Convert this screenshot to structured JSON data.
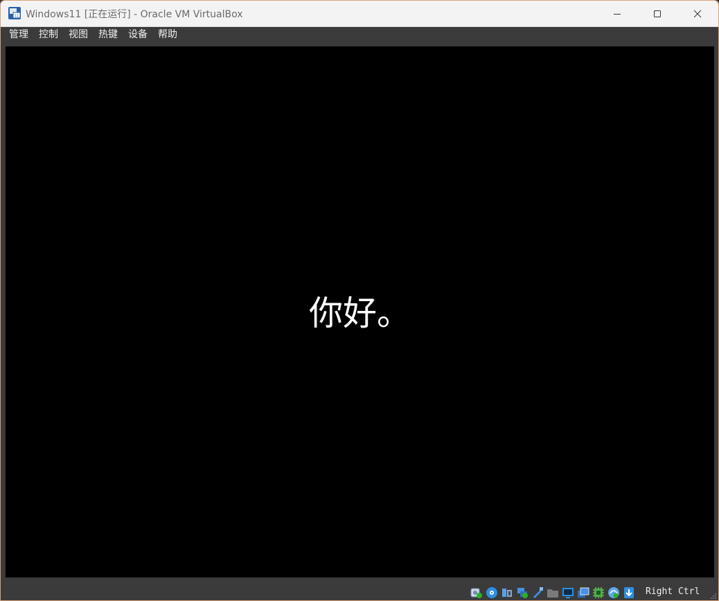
{
  "window": {
    "title": "Windows11 [正在运行] - Oracle VM VirtualBox"
  },
  "menu": {
    "items": [
      {
        "label": "管理"
      },
      {
        "label": "控制"
      },
      {
        "label": "视图"
      },
      {
        "label": "热键"
      },
      {
        "label": "设备"
      },
      {
        "label": "帮助"
      }
    ]
  },
  "vm": {
    "greeting": "你好。"
  },
  "status": {
    "host_key": "Right Ctrl",
    "icons": [
      "hard-disk-icon",
      "optical-drive-icon",
      "audio-icon",
      "network-icon",
      "usb-icon",
      "shared-folders-icon",
      "display-icon",
      "recording-icon",
      "cpu-icon",
      "mouse-integration-icon",
      "keyboard-capture-icon"
    ]
  },
  "colors": {
    "chrome": "#3b3b3b",
    "titlebar": "#f3f3f3",
    "screen": "#000000",
    "text_light": "#f0f0f0",
    "title_text": "#6a6a6a"
  }
}
